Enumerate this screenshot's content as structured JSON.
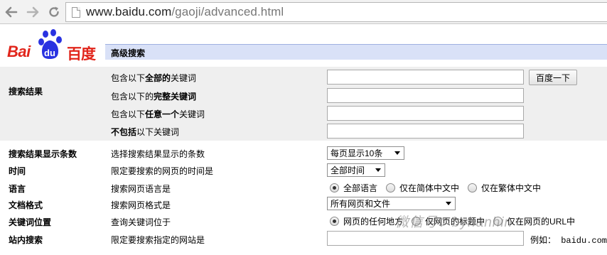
{
  "browser": {
    "url_host": "www.baidu.com",
    "url_path": "/gaoji/advanced.html"
  },
  "logo": {
    "text_bai": "Bai",
    "text_du": "du",
    "text_cn": "百度"
  },
  "header": {
    "title": "高级搜索"
  },
  "search_results": {
    "label": "搜索结果",
    "rows": [
      {
        "pre": "包含以下",
        "bold": "全部的",
        "post": "关键词"
      },
      {
        "pre": "包含以下的",
        "bold": "完整关键词",
        "post": ""
      },
      {
        "pre": "包含以下",
        "bold": "任意一个",
        "post": "关键词"
      },
      {
        "pre": "",
        "bold": "不包括",
        "post": "以下关键词"
      }
    ],
    "submit_label": "百度一下"
  },
  "result_count": {
    "label": "搜索结果显示条数",
    "desc": "选择搜索结果显示的条数",
    "selected": "每页显示10条"
  },
  "time": {
    "label": "时间",
    "desc": "限定要搜索的网页的时间是",
    "selected": "全部时间"
  },
  "language": {
    "label": "语言",
    "desc": "搜索网页语言是",
    "options": [
      "全部语言",
      "仅在简体中文中",
      "仅在繁体中文中"
    ],
    "checked_index": 0
  },
  "doc_format": {
    "label": "文档格式",
    "desc": "搜索网页格式是",
    "selected": "所有网页和文件"
  },
  "keyword_position": {
    "label": "关键词位置",
    "desc": "查询关键词位于",
    "options": [
      "网页的任何地方",
      "仅网页的标题中",
      "仅在网页的URL中"
    ],
    "checked_index": 0
  },
  "site_search": {
    "label": "站内搜索",
    "desc": "限定要搜索指定的网站是",
    "example": "例如： baidu.com"
  },
  "watermark": {
    "text": "微信号：byhanhin"
  },
  "colors": {
    "header_bar": "#d9e1f7",
    "results_bg": "#efefef",
    "logo_red": "#e1251b",
    "logo_blue": "#2932e1"
  }
}
